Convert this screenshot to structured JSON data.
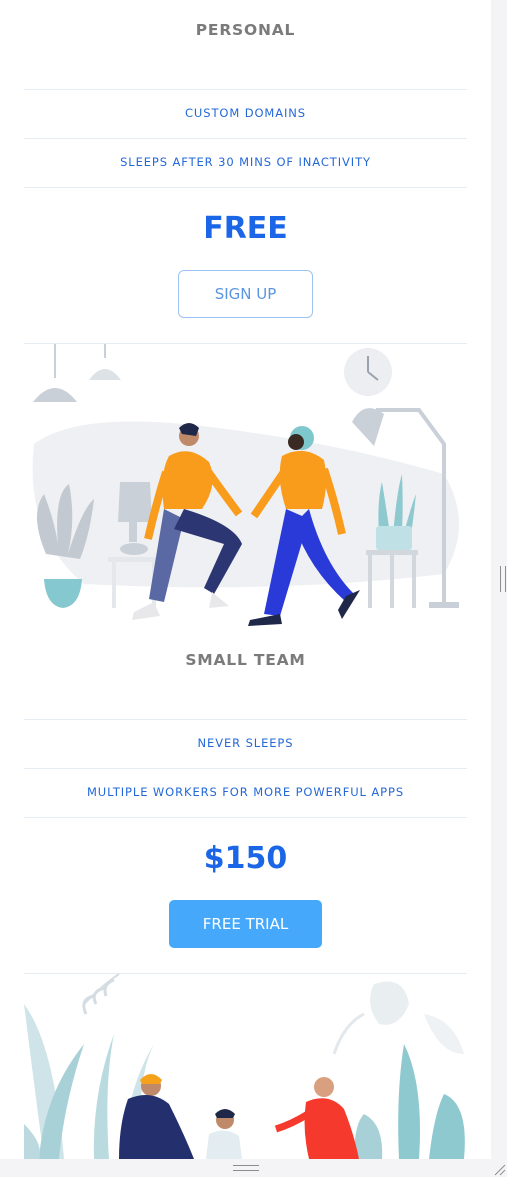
{
  "plans": [
    {
      "title": "PERSONAL",
      "features": [
        "CUSTOM DOMAINS",
        "SLEEPS AFTER 30 MINS OF INACTIVITY"
      ],
      "price": "FREE",
      "button_label": "SIGN UP"
    },
    {
      "title": "SMALL TEAM",
      "features": [
        "NEVER SLEEPS",
        "MULTIPLE WORKERS FOR MORE POWERFUL APPS"
      ],
      "price": "$150",
      "button_label": "FREE TRIAL"
    }
  ],
  "colors": {
    "accent": "#1a66e6",
    "feature_text": "#2468d8",
    "button_solid": "#46a8fb",
    "button_outline_border": "#9cc4f4",
    "title_gray": "#7b7b7b"
  }
}
